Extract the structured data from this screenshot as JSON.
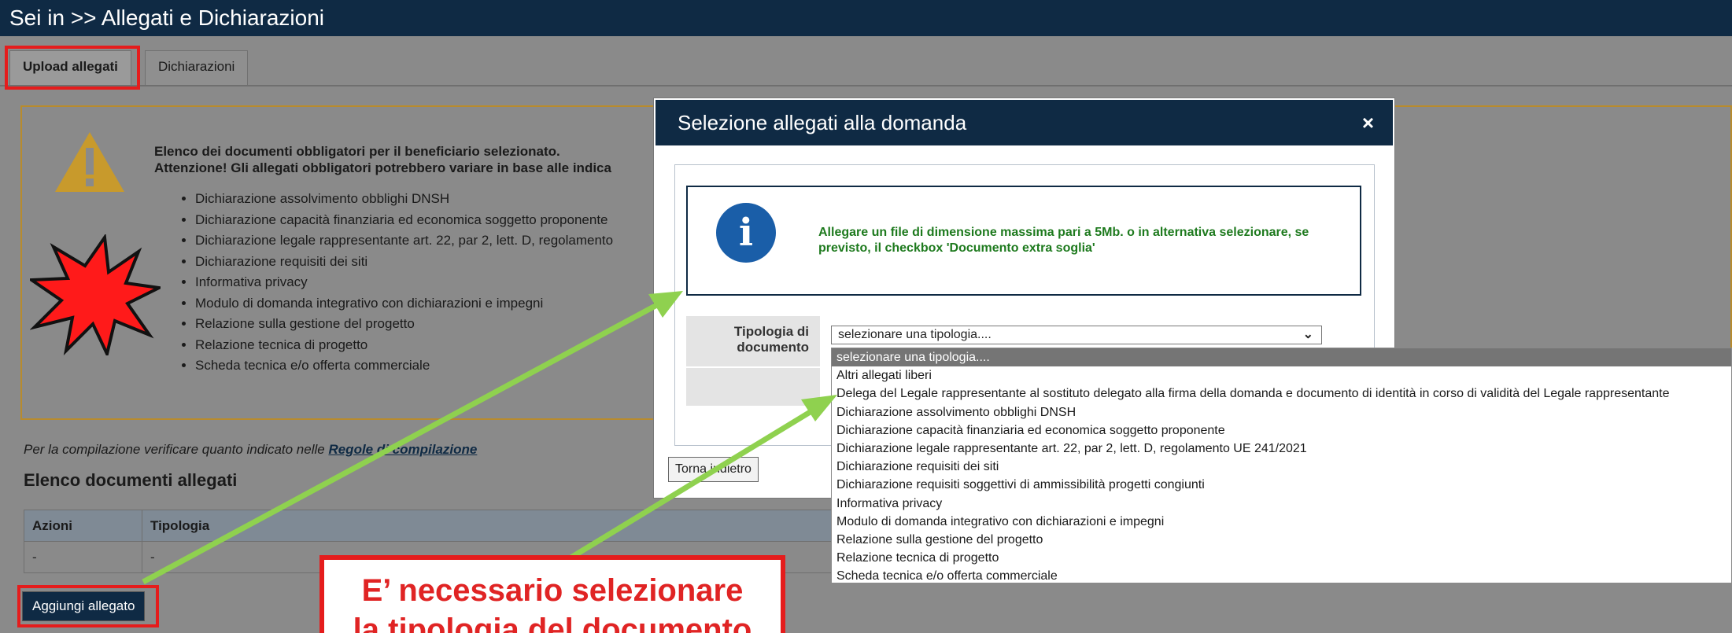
{
  "header": {
    "title": "Sei in >> Allegati e Dichiarazioni"
  },
  "tabs": [
    {
      "label": "Upload allegati",
      "active": true
    },
    {
      "label": "Dichiarazioni",
      "active": false
    }
  ],
  "warning": {
    "icon": "warning-triangle-icon",
    "title_line1": "Elenco dei documenti obbligatori per il beneficiario selezionato.",
    "title_line2": "Attenzione! Gli allegati obbligatori potrebbero variare in base alle indica",
    "items": [
      "Dichiarazione assolvimento obblighi DNSH",
      "Dichiarazione capacità finanziaria ed economica soggetto proponente",
      "Dichiarazione legale rappresentante art. 22, par 2, lett. D, regolamento",
      "Dichiarazione requisiti dei siti",
      "Informativa privacy",
      "Modulo di domanda integrativo con dichiarazioni e impegni",
      "Relazione sulla gestione del progetto",
      "Relazione tecnica di progetto",
      "Scheda tecnica e/o offerta commerciale"
    ]
  },
  "compilation": {
    "note": "Per la compilazione verificare quanto indicato nelle ",
    "link": "Regole di compilazione"
  },
  "documents": {
    "heading": "Elenco documenti allegati",
    "columns": [
      "Azioni",
      "Tipologia"
    ],
    "rows": [
      [
        "-",
        "-"
      ]
    ],
    "add_button": "Aggiungi allegato"
  },
  "modal": {
    "title": "Selezione allegati alla domanda",
    "close": "×",
    "info_icon": "i",
    "info_text": "Allegare un file di dimensione massima pari a 5Mb. o in alternativa selezionare, se previsto, il checkbox 'Documento extra soglia'",
    "field_label": "Tipologia di documento",
    "select_value": "selezionare una tipologia....",
    "back_button": "Torna indietro"
  },
  "dropdown": {
    "options": [
      "selezionare una tipologia....",
      "Altri allegati liberi",
      "Delega del Legale rappresentante al sostituto delegato alla firma della domanda e documento di identità in corso di validità del Legale rappresentante",
      "Dichiarazione assolvimento obblighi DNSH",
      "Dichiarazione capacità finanziaria ed economica soggetto proponente",
      "Dichiarazione legale rappresentante art. 22, par 2, lett. D, regolamento UE 241/2021",
      "Dichiarazione requisiti dei siti",
      "Dichiarazione requisiti soggettivi di ammissibilità progetti congiunti",
      "Informativa privacy",
      "Modulo di domanda integrativo con dichiarazioni e impegni",
      "Relazione sulla gestione del progetto",
      "Relazione tecnica di progetto",
      "Scheda tecnica e/o offerta commerciale"
    ],
    "selected_index": 0
  },
  "annotation": {
    "callout_line1": "E’ necessario selezionare",
    "callout_line2": "la tipologia del documento",
    "arrow_color": "#8fd14f",
    "highlight_color": "#e51c1c"
  }
}
